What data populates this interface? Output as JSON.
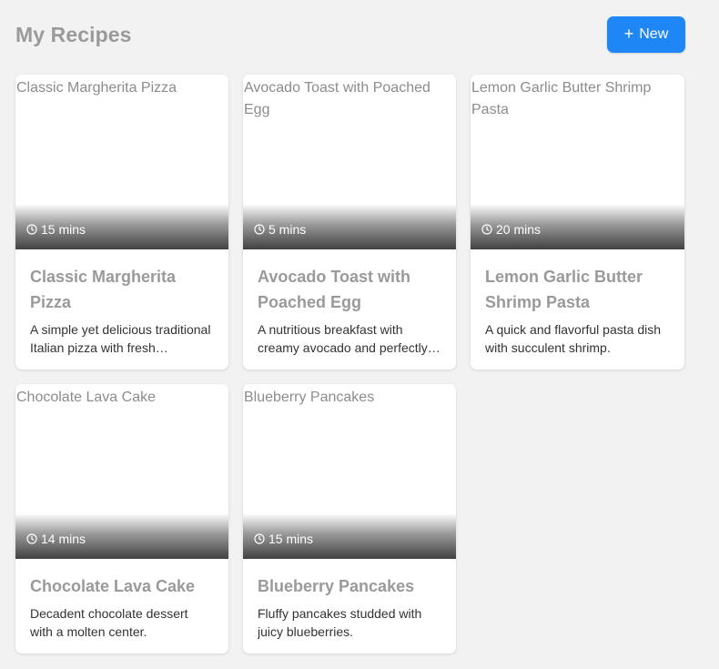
{
  "header": {
    "title": "My Recipes",
    "new_button_label": "New"
  },
  "recipes": [
    {
      "image_alt": "Classic Margherita Pizza",
      "time": "15 mins",
      "title": "Classic Margherita Pizza",
      "description": "A simple yet delicious traditional Italian pizza with fresh ingredients."
    },
    {
      "image_alt": "Avocado Toast with Poached Egg",
      "time": "5 mins",
      "title": "Avocado Toast with Poached Egg",
      "description": "A nutritious breakfast with creamy avocado and perfectly poached egg."
    },
    {
      "image_alt": "Lemon Garlic Butter Shrimp Pasta",
      "time": "20 mins",
      "title": "Lemon Garlic Butter Shrimp Pasta",
      "description": "A quick and flavorful pasta dish with succulent shrimp."
    },
    {
      "image_alt": "Chocolate Lava Cake",
      "time": "14 mins",
      "title": "Chocolate Lava Cake",
      "description": "Decadent chocolate dessert with a molten center."
    },
    {
      "image_alt": "Blueberry Pancakes",
      "time": "15 mins",
      "title": "Blueberry Pancakes",
      "description": "Fluffy pancakes studded with juicy blueberries."
    }
  ],
  "colors": {
    "accent": "#1f87f5",
    "background": "#f2f2f2",
    "title_text": "#9a9a9a"
  },
  "icons": {
    "new_button": "plus-icon",
    "time": "clock-icon"
  }
}
